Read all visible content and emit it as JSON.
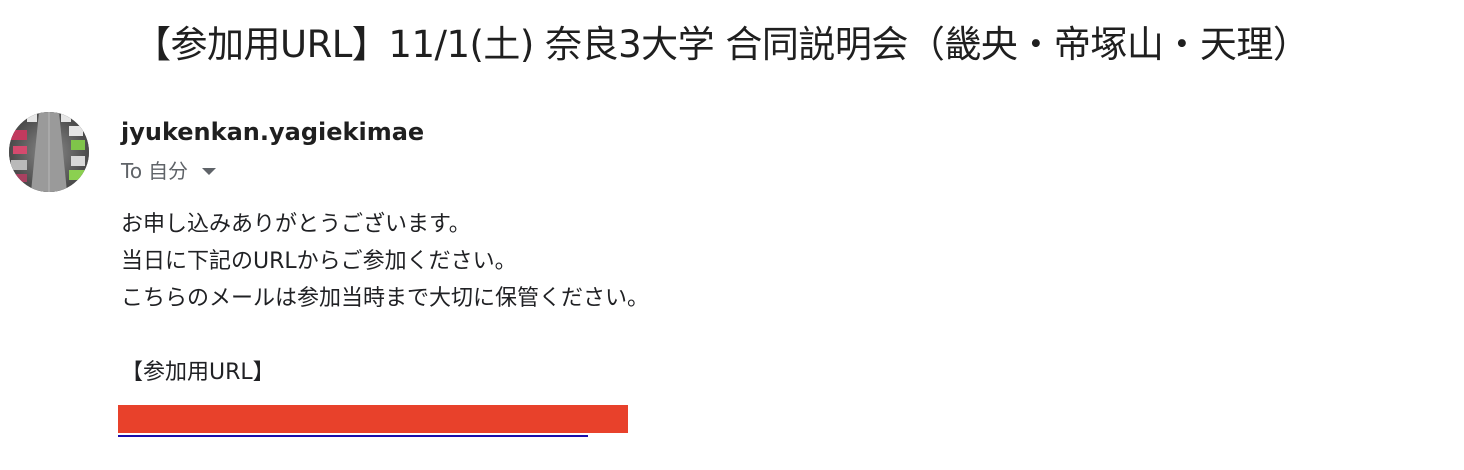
{
  "email": {
    "subject": "【参加用URL】11/1(土) 奈良3大学 合同説明会（畿央・帝塚山・天理）",
    "sender": "jyukenkan.yagiekimae",
    "to_label": "To",
    "to_value": "自分",
    "body_lines": [
      "お申し込みありがとうございます。",
      "当日に下記のURLからご参加ください。",
      "こちらのメールは参加当時まで大切に保管ください。",
      "",
      "【参加用URL】"
    ]
  },
  "colors": {
    "redaction": "#e8412b",
    "link": "#1a0dab"
  },
  "icons": {
    "recipient_details": "chevron-down-icon",
    "avatar": "sender-avatar"
  }
}
